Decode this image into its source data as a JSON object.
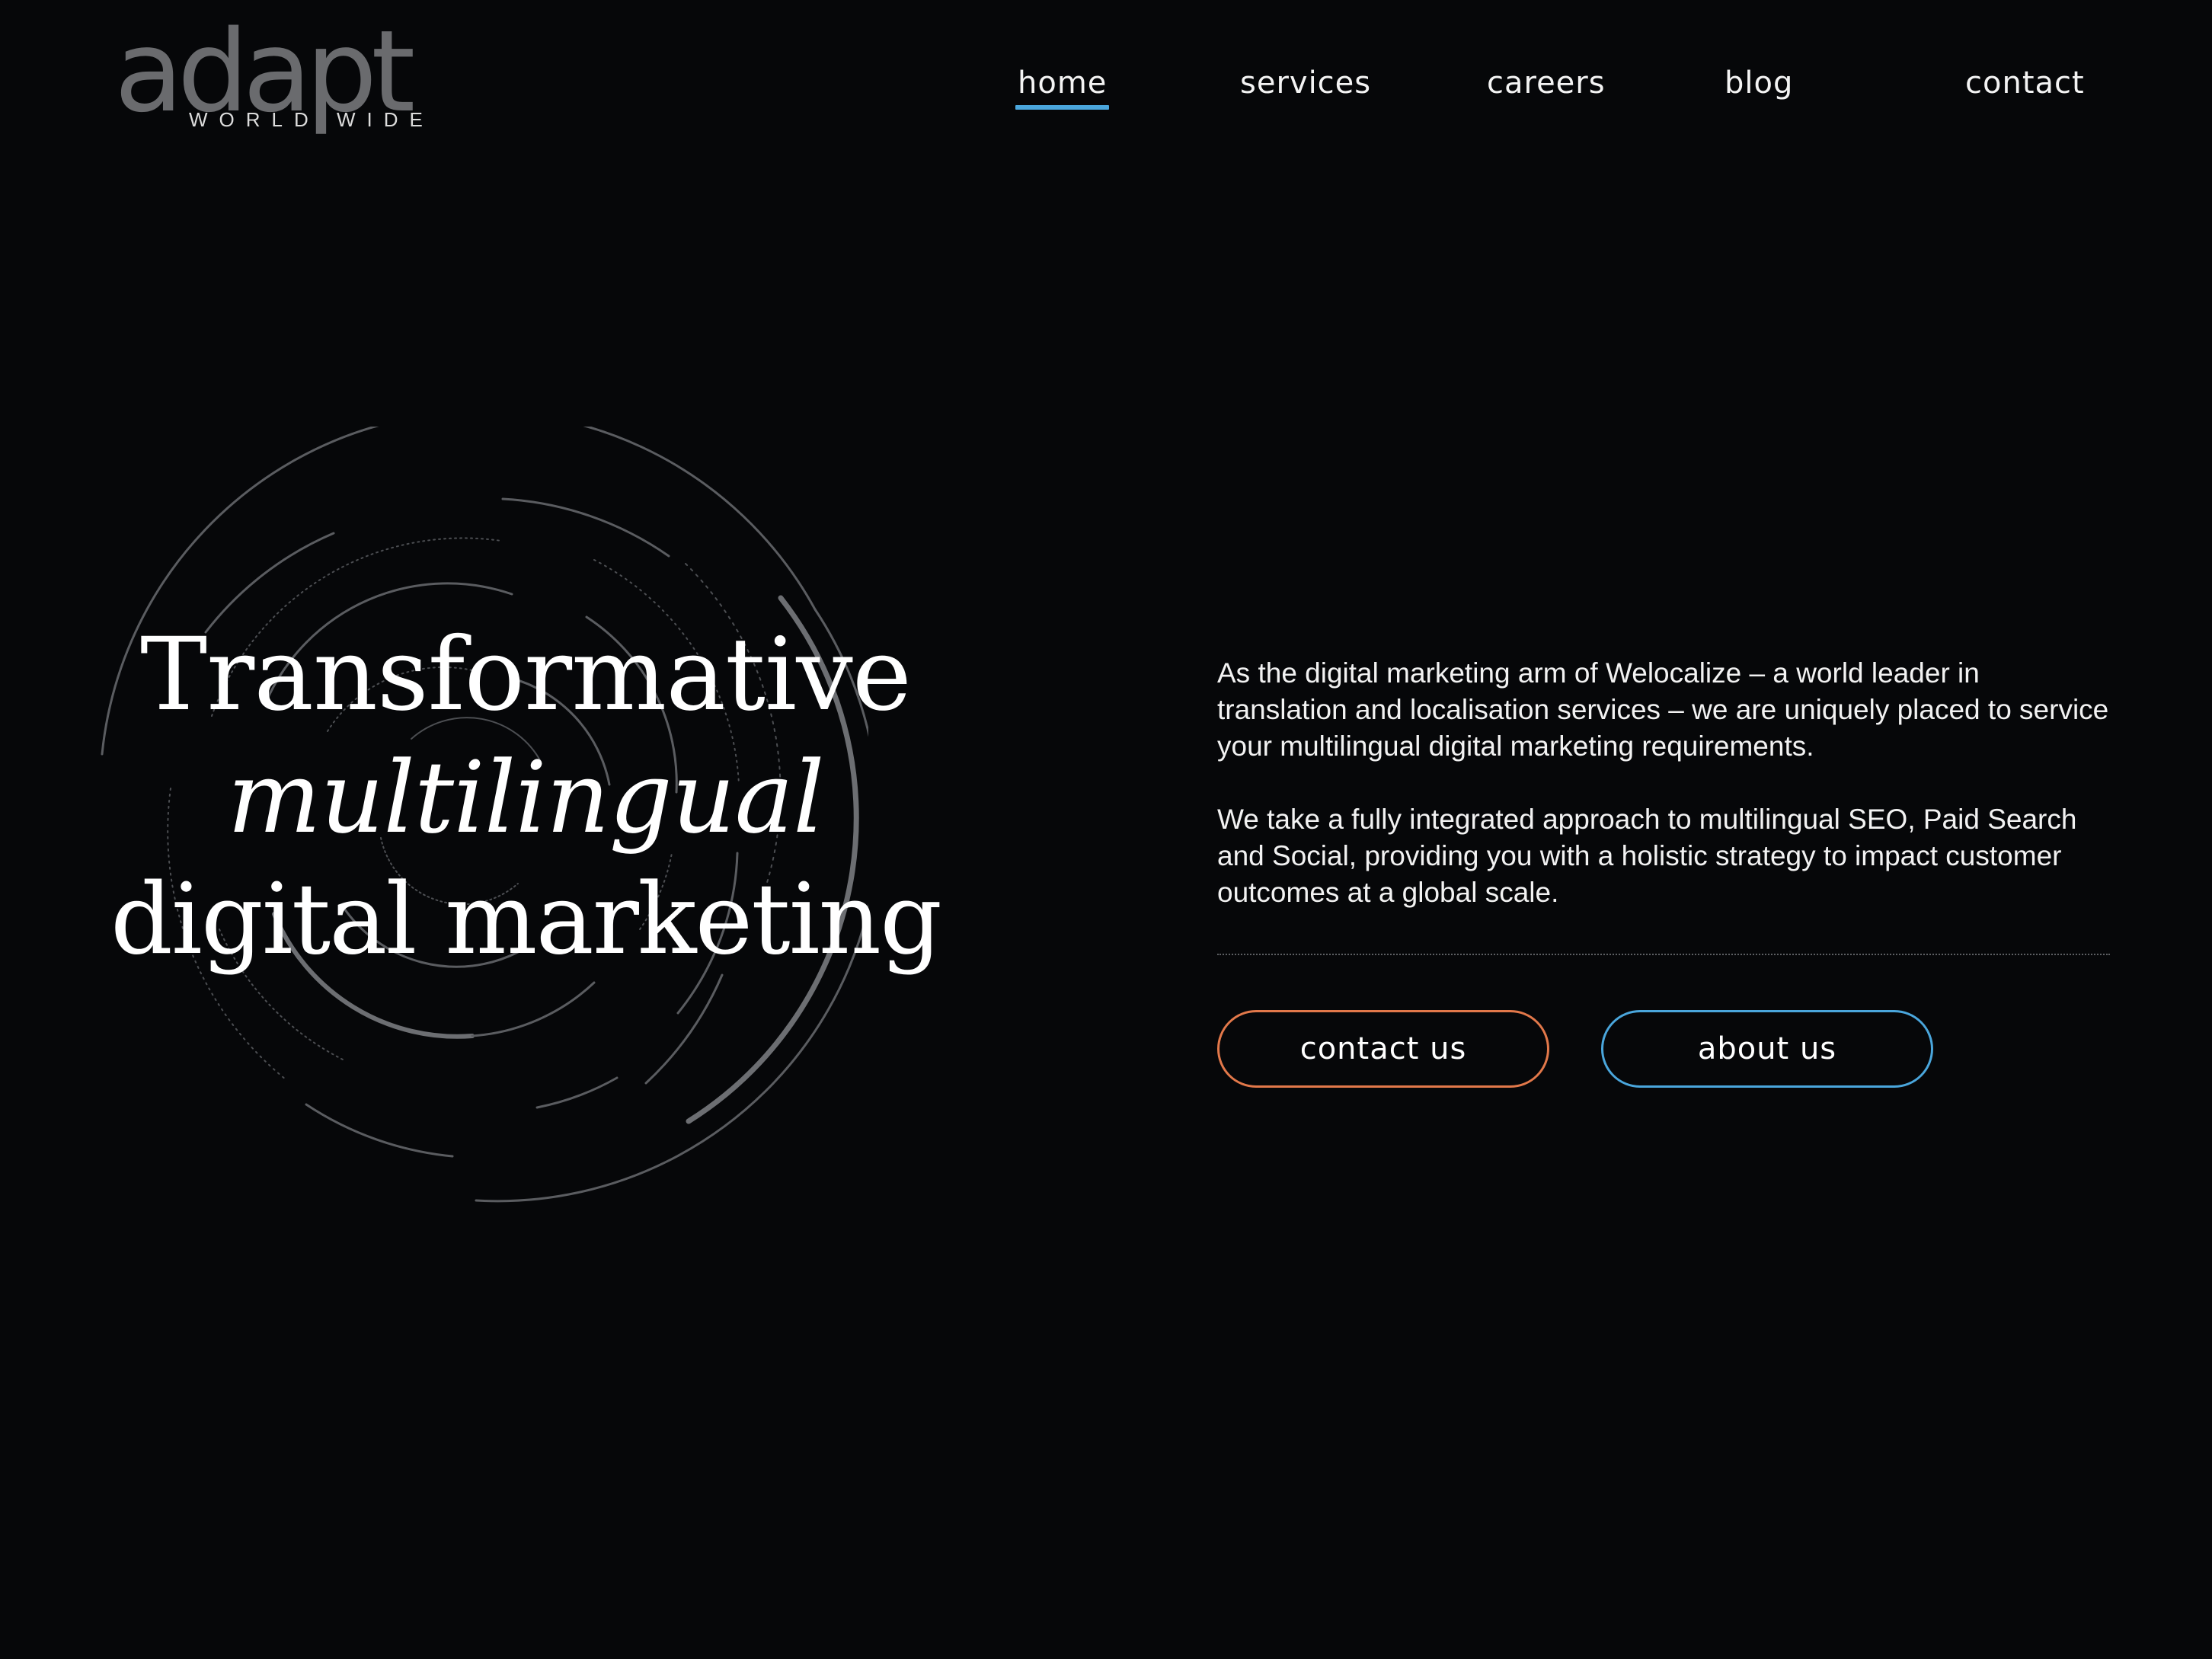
{
  "brand": {
    "wordmark": "adapt",
    "tagline": "WORLD WIDE"
  },
  "nav": {
    "items": [
      {
        "label": "home",
        "active": true
      },
      {
        "label": "services",
        "active": false
      },
      {
        "label": "careers",
        "active": false
      },
      {
        "label": "blog",
        "active": false
      },
      {
        "label": "contact",
        "active": false
      }
    ]
  },
  "hero": {
    "headline_line1": "Transformative",
    "headline_line2": "multilingual",
    "headline_line3": "digital marketing",
    "decoration_icon": "concentric-orbit-rings"
  },
  "intro": {
    "paragraph1": "As the digital marketing arm of Welocalize – a world leader in translation and localisation services – we are uniquely placed to service your multilingual digital marketing requirements.",
    "paragraph2": "We take a fully integrated approach to multilingual SEO, Paid Search and Social, providing you with a holistic strategy to impact customer outcomes at a global scale."
  },
  "actions": {
    "contact_label": "contact us",
    "about_label": "about us"
  },
  "colors": {
    "background": "#060709",
    "text": "#ffffff",
    "accent_blue": "#4aa6dc",
    "accent_orange": "#e2784a",
    "logo_grey": "#6a6b6e"
  }
}
